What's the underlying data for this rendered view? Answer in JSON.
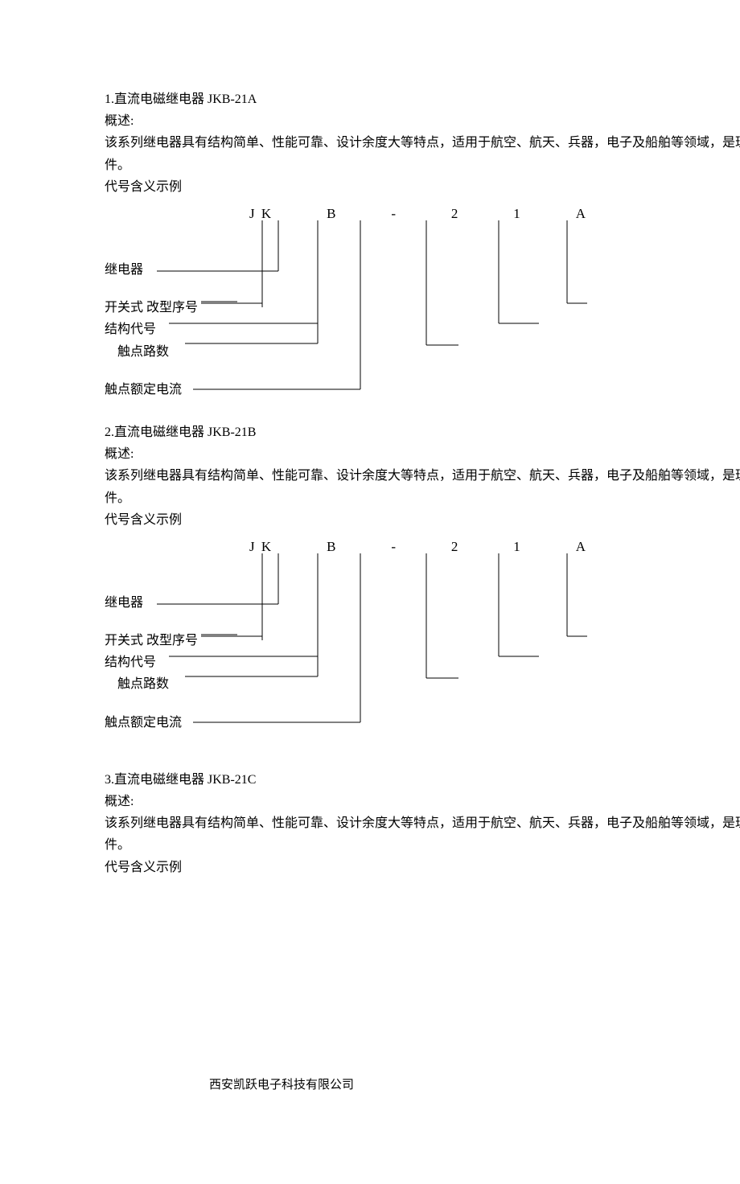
{
  "sections": [
    {
      "title": "1.直流电磁继电器 JKB-21A",
      "overview_label": "概述:",
      "overview_text": "该系列继电器具有结构简单、性能可靠、设计余度大等特点，适用于航空、航天、兵器，电子及船舶等领域，是理想的线路开关元件。",
      "code_label": "代号含义示例",
      "code_parts": [
        "J K",
        "B",
        "-",
        "2",
        "1",
        "A"
      ],
      "labels": {
        "relay": "继电器",
        "switch_mod": "开关式   改型序号",
        "struct": "结构代号",
        "contact_count": "触点路数",
        "rated_current": "触点额定电流"
      }
    },
    {
      "title": "2.直流电磁继电器 JKB-21B",
      "overview_label": "概述:",
      "overview_text": "该系列继电器具有结构简单、性能可靠、设计余度大等特点，适用于航空、航天、兵器，电子及船舶等领域，是理想的线路开关元件。",
      "code_label": "代号含义示例",
      "code_parts": [
        "J K",
        "B",
        "-",
        "2",
        "1",
        "A"
      ],
      "labels": {
        "relay": "继电器",
        "switch_mod": "开关式   改型序号",
        "struct": "结构代号",
        "contact_count": "触点路数",
        "rated_current": "触点额定电流"
      }
    },
    {
      "title": "3.直流电磁继电器 JKB-21C",
      "overview_label": "概述:",
      "overview_text": "该系列继电器具有结构简单、性能可靠、设计余度大等特点，适用于航空、航天、兵器，电子及船舶等领域，是理想的线路开关元件。",
      "code_label": "代号含义示例"
    }
  ],
  "footer": "西安凯跃电子科技有限公司"
}
